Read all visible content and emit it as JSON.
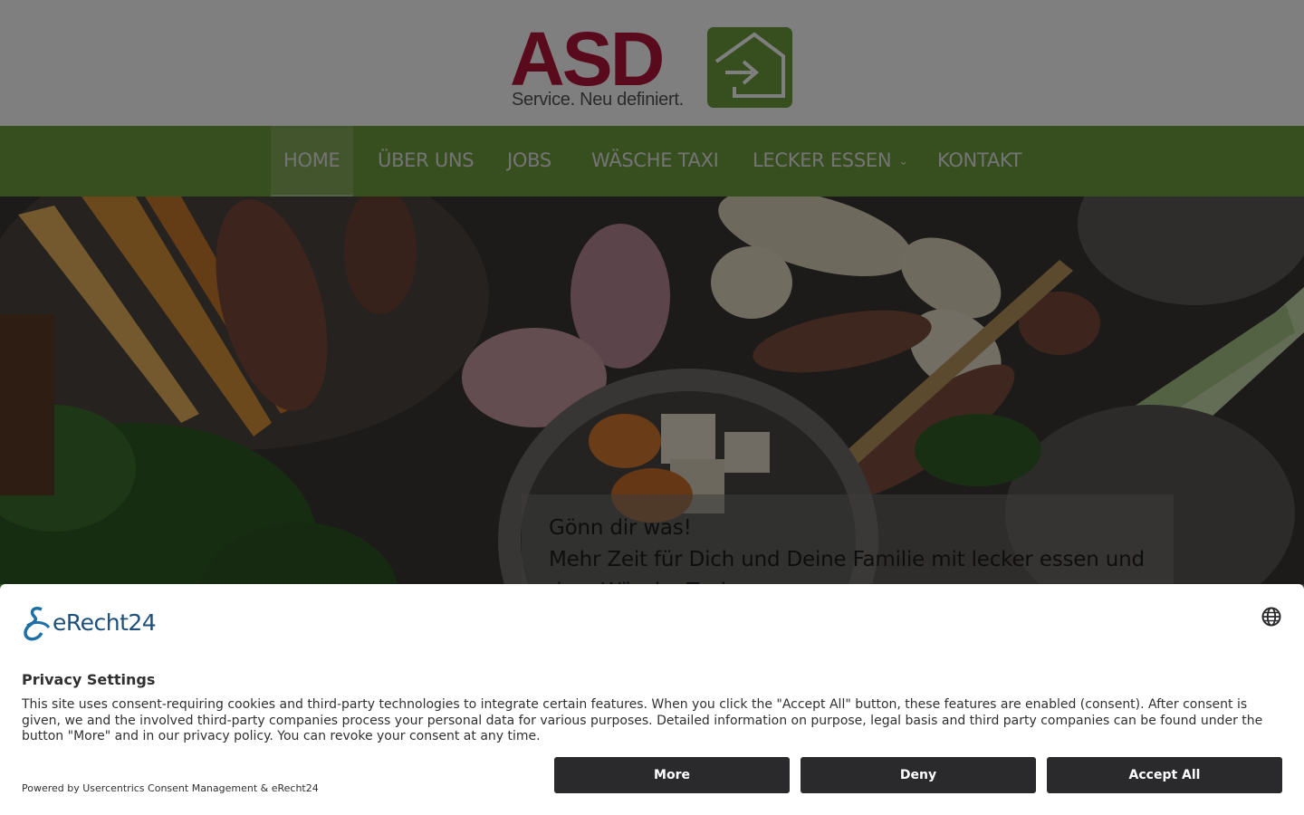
{
  "header": {
    "logo_text": "ASD",
    "logo_slogan": "Service. Neu definiert.",
    "logo_icon": "house-arrow-icon",
    "brand_colors": {
      "red": "#b5153a",
      "green": "#6f9c3e"
    }
  },
  "nav": {
    "items": [
      {
        "label": "HOME",
        "active": true
      },
      {
        "label": "ÜBER UNS"
      },
      {
        "label": "JOBS"
      },
      {
        "label": "WÄSCHE TAXI"
      },
      {
        "label": "LECKER ESSEN",
        "icon": "chevron-down-icon"
      },
      {
        "label": "KONTAKT"
      }
    ]
  },
  "hero": {
    "line1": "Gönn dir was!",
    "line2": "Mehr Zeit für Dich und Deine Familie mit lecker essen und",
    "line3": "dem Wäsche Taxi."
  },
  "consent": {
    "brand": "eRecht24",
    "language_icon": "globe-icon",
    "title": "Privacy Settings",
    "text": "This site uses consent-requiring cookies and third-party technologies to integrate certain features. When you click the \"Accept All\" button, these features are enabled (consent). After consent is given, we and the involved third-party companies process your personal data for various purposes. Detailed information on purpose, legal basis and third party companies can be found under the button \"More\" and in our privacy policy. You can revoke your consent at any time.",
    "powered_by": "Powered by Usercentrics Consent Management & eRecht24",
    "buttons": {
      "more": "More",
      "deny": "Deny",
      "accept": "Accept All"
    },
    "button_color": "#2a2a2d"
  }
}
